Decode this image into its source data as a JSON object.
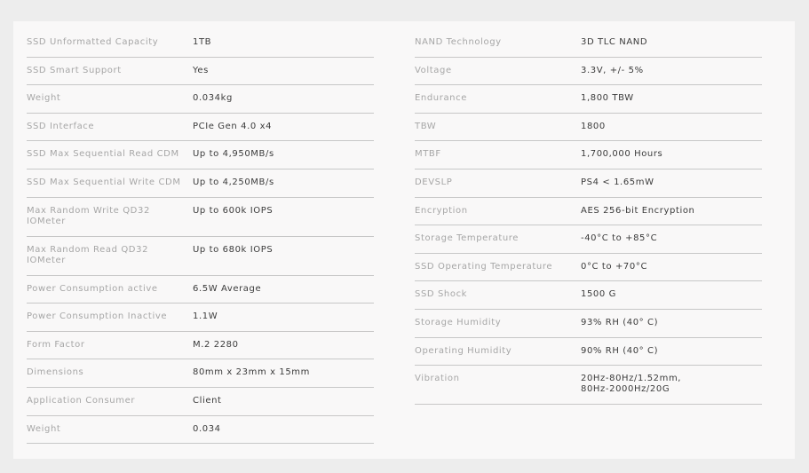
{
  "specs": {
    "left": [
      {
        "label": "SSD Unformatted Capacity",
        "value": "1TB"
      },
      {
        "label": "SSD Smart Support",
        "value": "Yes"
      },
      {
        "label": "Weight",
        "value": "0.034kg"
      },
      {
        "label": "SSD Interface",
        "value": "PCIe Gen 4.0 x4"
      },
      {
        "label": "SSD Max Sequential Read CDM",
        "value": "Up to 4,950MB/s"
      },
      {
        "label": "SSD Max Sequential Write CDM",
        "value": "Up to 4,250MB/s"
      },
      {
        "label": "Max Random Write QD32\nIOMeter",
        "value": "Up to 600k IOPS"
      },
      {
        "label": "Max Random Read QD32\nIOMeter",
        "value": "Up to 680k IOPS"
      },
      {
        "label": "Power Consumption active",
        "value": "6.5W Average"
      },
      {
        "label": "Power Consumption Inactive",
        "value": "1.1W"
      },
      {
        "label": "Form Factor",
        "value": "M.2 2280"
      },
      {
        "label": "Dimensions",
        "value": "80mm x 23mm x 15mm"
      },
      {
        "label": "Application Consumer",
        "value": "Client"
      },
      {
        "label": "Weight",
        "value": "0.034"
      }
    ],
    "right": [
      {
        "label": "NAND Technology",
        "value": "3D TLC NAND"
      },
      {
        "label": "Voltage",
        "value": "3.3V, +/- 5%"
      },
      {
        "label": "Endurance",
        "value": "1,800 TBW"
      },
      {
        "label": "TBW",
        "value": "1800"
      },
      {
        "label": "MTBF",
        "value": "1,700,000 Hours"
      },
      {
        "label": "DEVSLP",
        "value": "PS4 < 1.65mW"
      },
      {
        "label": "Encryption",
        "value": "AES 256-bit Encryption"
      },
      {
        "label": "Storage Temperature",
        "value": "-40°C to +85°C"
      },
      {
        "label": "SSD Operating Temperature",
        "value": "0°C to +70°C"
      },
      {
        "label": "SSD Shock",
        "value": "1500 G"
      },
      {
        "label": "Storage Humidity",
        "value": "93% RH (40° C)"
      },
      {
        "label": "Operating Humidity",
        "value": "90% RH (40° C)"
      },
      {
        "label": "Vibration",
        "value": "20Hz-80Hz/1.52mm,\n80Hz-2000Hz/20G"
      }
    ]
  }
}
